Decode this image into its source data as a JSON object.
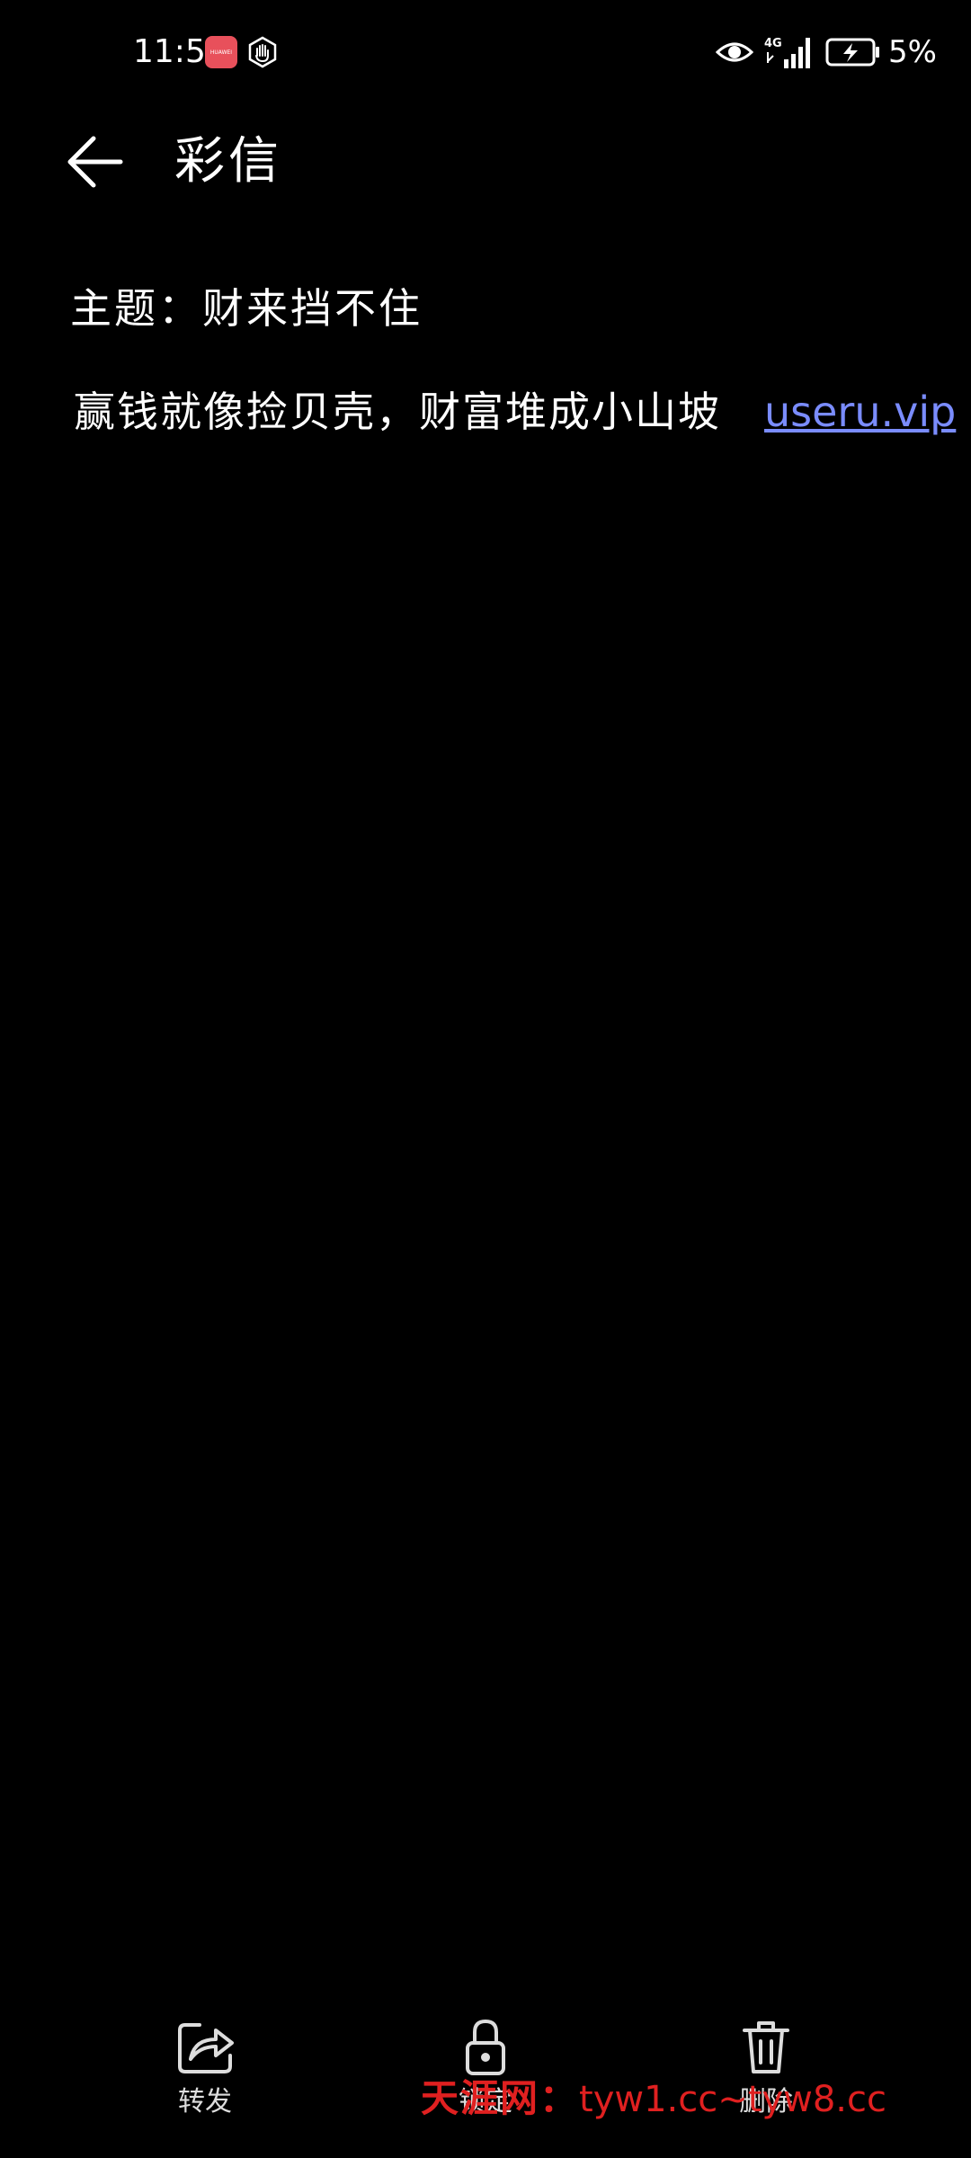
{
  "status_bar": {
    "time": "11:57",
    "app_badge_text": "HUAWEI",
    "network": "4G",
    "battery_percent": "5%"
  },
  "header": {
    "title": "彩信"
  },
  "message": {
    "subject": "主题：财来挡不住",
    "body": "赢钱就像捡贝壳，财富堆成小山坡",
    "link": "useru.vip"
  },
  "toolbar": {
    "forward_label": "转发",
    "lock_label": "锁定",
    "delete_label": "删除"
  },
  "watermark": {
    "brand": "天涯网：",
    "urls": "tyw1.cc~tyw8.cc"
  },
  "colors": {
    "background": "#000000",
    "text": "#ffffff",
    "link": "#7a8cff",
    "watermark": "#e02020",
    "app_badge": "#e8505b"
  }
}
